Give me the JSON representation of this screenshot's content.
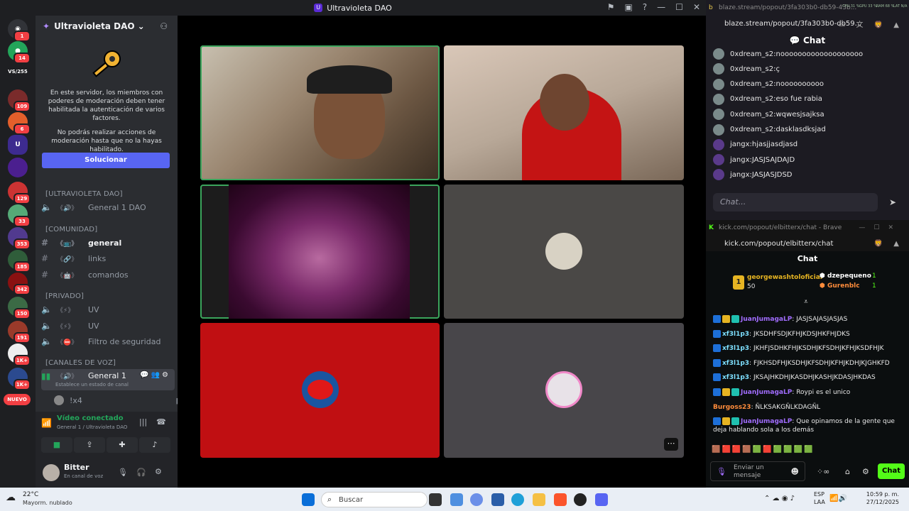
{
  "window": {
    "title": "Ultravioleta DAO"
  },
  "rail": {
    "badges": [
      "1",
      "14",
      "109",
      "6",
      "129",
      "33",
      "353",
      "185",
      "342",
      "150",
      "191",
      "1K+",
      "1K+"
    ],
    "nuevo": "NUEVO",
    "dm_label": "VS/255"
  },
  "sidebar": {
    "server_name": "Ultravioleta DAO",
    "mod_text_1": "En este servidor, los miembros con poderes de moderación deben tener habilitada la autenticación de varios factores.",
    "mod_text_2": "No podrás realizar acciones de moderación hasta que no la hayas habilitado.",
    "fix_button": "Solucionar",
    "categories": [
      "[ULTRAVIOLETA DAO]",
      "[COMUNIDAD]",
      "[PRIVADO]",
      "[CANALES DE VOZ]"
    ],
    "channels": {
      "general_dao": "General 1 DAO",
      "general": "general",
      "links": "links",
      "comandos": "comandos",
      "uv1": "UV",
      "uv2": "UV",
      "filtro": "Filtro de seguridad",
      "general1": "General 1",
      "status_hint": "Establece un estado de canal",
      "member": "!x4"
    }
  },
  "voice": {
    "status": "Vídeo conectado",
    "location": "General 1 / Ultravioleta DAO"
  },
  "user": {
    "name": "Bitter",
    "status": "En canal de voz"
  },
  "brave1": {
    "title": "blaze.stream/popout/3fa303b0-db59-43b...",
    "url": "blaze.stream/popout/3fa303b0-db59...",
    "stats": [
      "CPU 31 %",
      "GPU 33 %",
      "RAM 68 %",
      "LAT N/A"
    ],
    "chat_title": "Chat",
    "placeholder": "Chat...",
    "messages": [
      {
        "user": "0xdream_s2",
        "text": "nooooooooooooooooooo"
      },
      {
        "user": "0xdream_s2",
        "text": "ç"
      },
      {
        "user": "0xdream_s2",
        "text": "noooooooooo"
      },
      {
        "user": "0xdream_s2",
        "text": "eso fue rabia"
      },
      {
        "user": "0xdream_s2",
        "text": "wqwesjsajksa"
      },
      {
        "user": "0xdream_s2",
        "text": "dasklasdksjad"
      },
      {
        "user": "jangx",
        "text": "hjasjjasdjasd"
      },
      {
        "user": "jangx",
        "text": "JASJSAJDAJD"
      },
      {
        "user": "jangx",
        "text": "JASJASJDSD"
      }
    ]
  },
  "brave2": {
    "title": "kick.com/popout/elbitterx/chat - Brave",
    "url": "kick.com/popout/elbitterx/chat",
    "chat_title": "Chat",
    "top_gifter": {
      "name": "georgewashtoloficial",
      "amount": "50"
    },
    "gifters": [
      {
        "name": "dzepequeno",
        "amount": "1"
      },
      {
        "name": "Gurenblc",
        "amount": "1"
      }
    ],
    "messages": [
      {
        "user": "JuanJumagaLP",
        "text": "JASJSAJASJASJAS",
        "color": "#a16dff"
      },
      {
        "user": "xf3l1p3",
        "text": "JKSDHFSDJKFHJKDSJHKFHJDKS",
        "color": "#7ee0ff"
      },
      {
        "user": "xf3l1p3",
        "text": "JKHFJSDHKFHJKSDHJKFSDHJKFHJKSDFHJK",
        "color": "#7ee0ff"
      },
      {
        "user": "xf3l1p3",
        "text": "FJKHSDFHJKSDHJKFSDHJKFHJKDHJKJGHKFD",
        "color": "#7ee0ff"
      },
      {
        "user": "xf3l1p3",
        "text": "JKSAJHKDHJKASDHJKASHJKDASJHKDAS",
        "color": "#7ee0ff"
      },
      {
        "user": "JuanJumagaLP",
        "text": "Roypi es el unico",
        "color": "#a16dff"
      },
      {
        "user": "Burgoss23",
        "text": "ÑLKSAKGÑLKDAGÑL",
        "color": "#ff8c3b"
      },
      {
        "user": "JuanJumagaLP",
        "text": "Que opinamos de la gente que deja hablando sola a los demás",
        "color": "#a16dff"
      }
    ],
    "input_placeholder": "Enviar un mensaje",
    "chat_button": "Chat"
  },
  "taskbar": {
    "weather_temp": "22°C",
    "weather_desc": "Mayorm. nublado",
    "search": "Buscar",
    "lang": "ESP",
    "lang2": "LAA",
    "time": "10:59 p. m.",
    "date": "27/12/2025"
  }
}
